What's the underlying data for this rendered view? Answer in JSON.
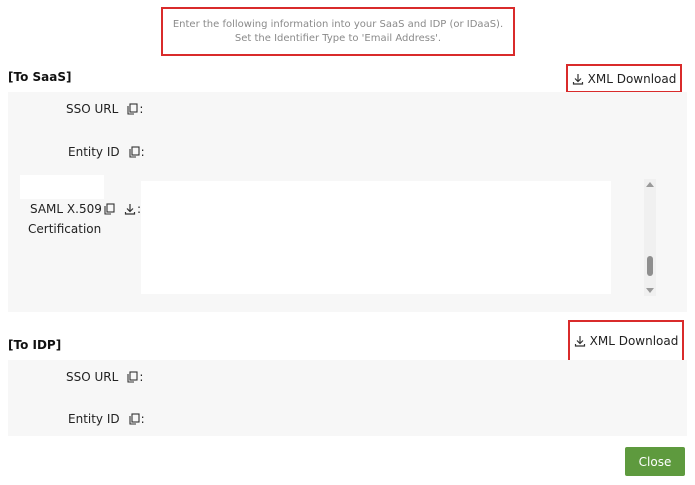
{
  "notice": {
    "line1": "Enter the following information into your SaaS and IDP (or IDaaS).",
    "line2": "Set the Identifier Type to 'Email Address'."
  },
  "to_saas": {
    "title": "[To SaaS]",
    "xml_download_label": "XML Download",
    "sso_url_label": "SSO URL",
    "entity_id_label": "Entity ID",
    "cert_label_line1": "SAML X.509",
    "cert_label_line2": "Certification",
    "sso_url_value": "",
    "entity_id_value": "",
    "certificate_value": ""
  },
  "to_idp": {
    "title": "[To IDP]",
    "xml_download_label": "XML Download",
    "sso_url_label": "SSO URL",
    "entity_id_label": "Entity ID",
    "sso_url_value": "",
    "entity_id_value": ""
  },
  "colon": ":",
  "footer": {
    "close_label": "Close"
  },
  "icons": {
    "copy": "copy-icon",
    "download": "download-icon"
  },
  "colors": {
    "highlight_border": "#d92b2b",
    "close_button": "#5e9a3e",
    "panel_background": "#f7f7f7"
  }
}
